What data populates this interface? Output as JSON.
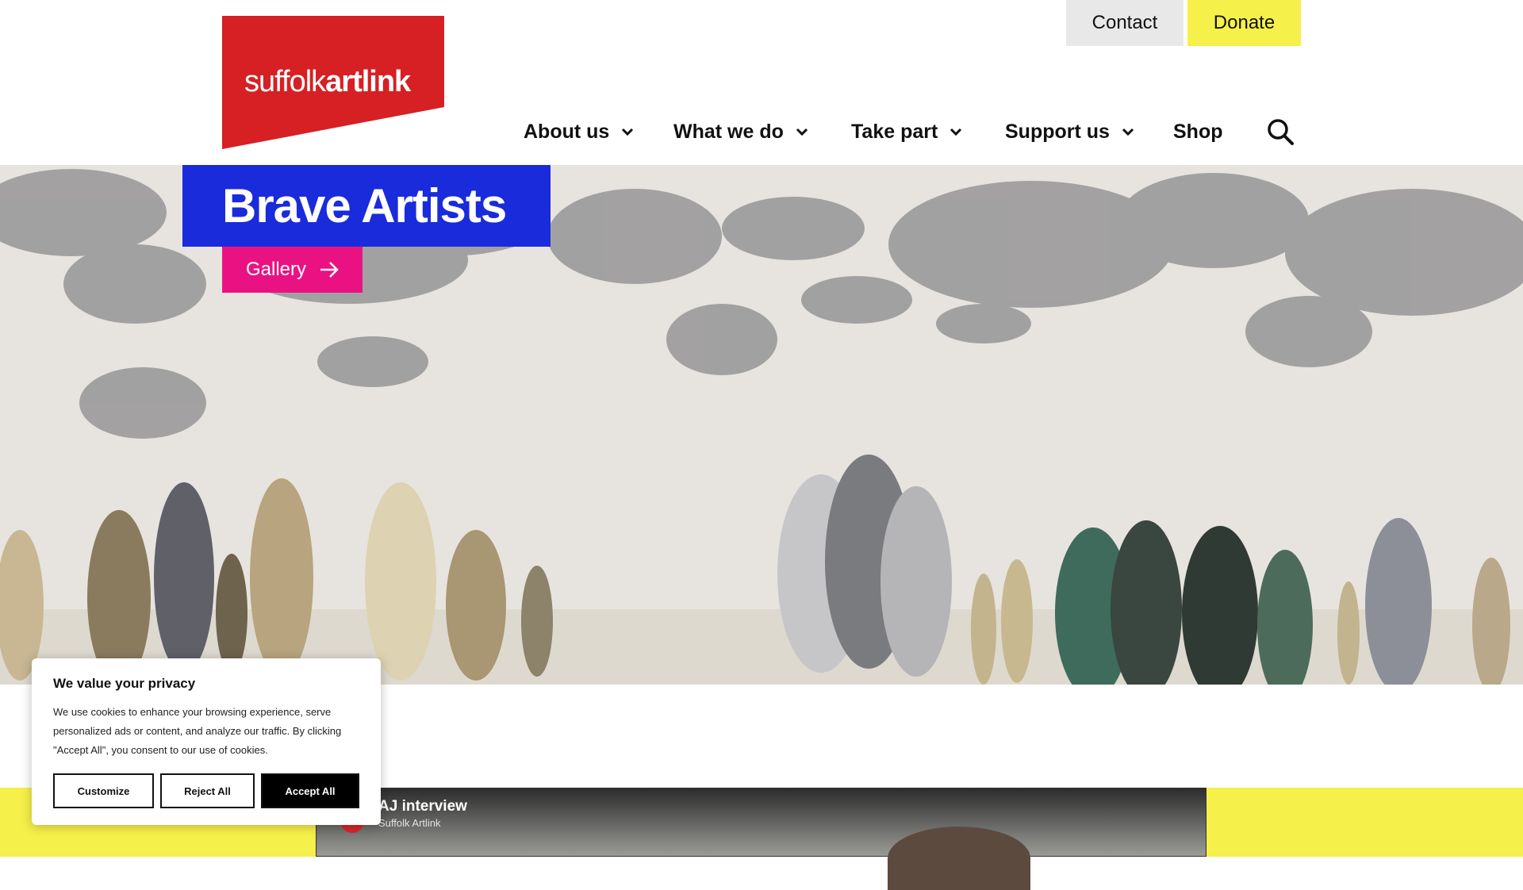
{
  "header": {
    "logo": {
      "light": "suffolk",
      "bold": "artlink",
      "color": "#d62024"
    },
    "top_links": {
      "contact": "Contact",
      "donate": "Donate"
    },
    "nav": [
      {
        "label": "About us",
        "has_dropdown": true,
        "icon": "chevron-down-icon"
      },
      {
        "label": "What we do",
        "has_dropdown": true,
        "icon": "chevron-down-icon"
      },
      {
        "label": "Take part",
        "has_dropdown": true,
        "icon": "chevron-down-icon"
      },
      {
        "label": "Support us",
        "has_dropdown": true,
        "icon": "chevron-down-icon"
      },
      {
        "label": "Shop",
        "has_dropdown": false
      }
    ],
    "search_icon": "search-icon"
  },
  "hero": {
    "title": "Brave Artists",
    "gallery_button": "Gallery",
    "gallery_icon": "arrow-right-icon",
    "title_bg": "#1a2bdc",
    "button_bg": "#ea1283"
  },
  "video": {
    "title": "AJ interview",
    "channel": "Suffolk Artlink"
  },
  "cookie_banner": {
    "heading": "We value your privacy",
    "body": "We use cookies to enhance your browsing experience, serve personalized ads or content, and analyze our traffic. By clicking \"Accept All\", you consent to our use of cookies.",
    "customize": "Customize",
    "reject": "Reject All",
    "accept": "Accept All"
  },
  "colors": {
    "accent_yellow": "#f6f04a",
    "contact_bg": "#e8e8e8"
  }
}
